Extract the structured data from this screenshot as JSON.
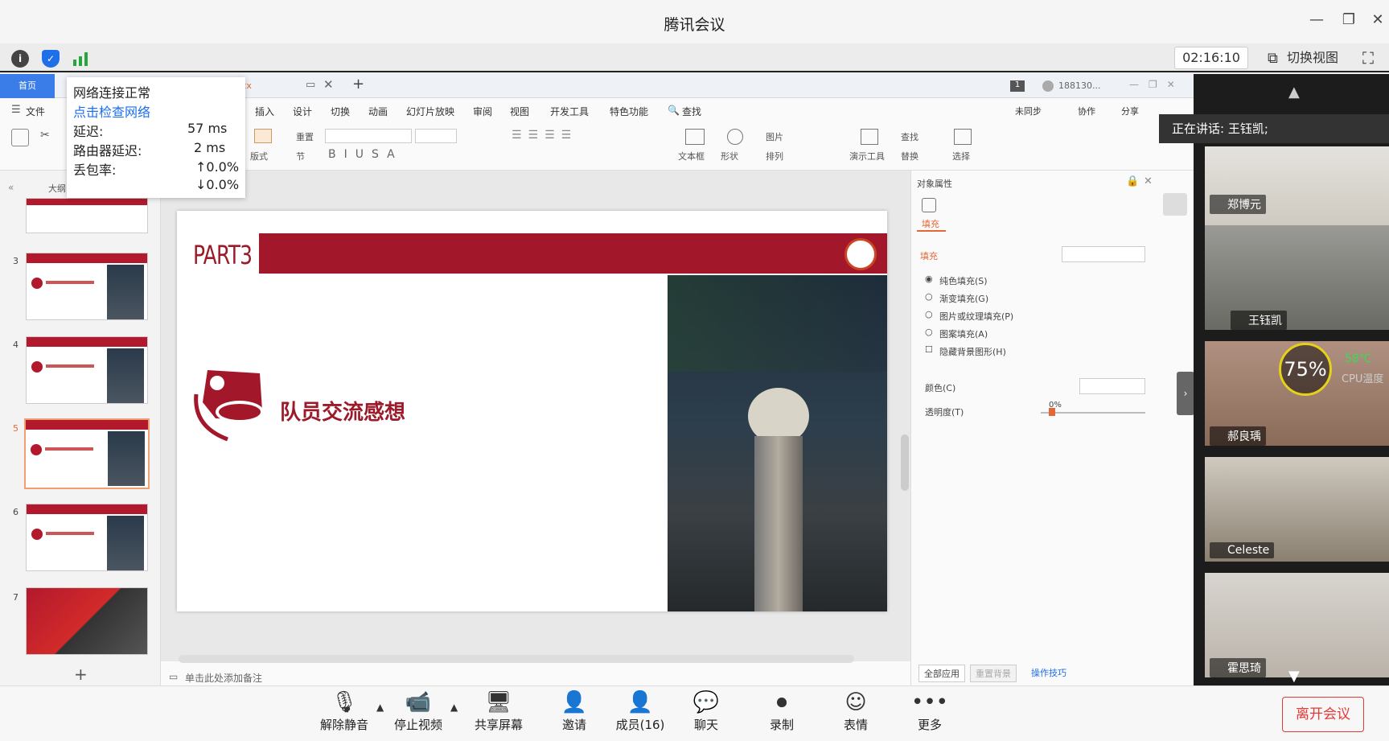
{
  "window": {
    "title": "腾讯会议",
    "timer": "02:16:10",
    "switch_view": "切换视图"
  },
  "network": {
    "status": "网络连接正常",
    "check": "点击检查网络",
    "latency_label": "延迟:",
    "latency": "57 ms",
    "router_label": "路由器延迟:",
    "router": "2 ms",
    "loss_label": "丢包率:",
    "loss_up": "↑0.0%",
    "loss_down": "↓0.0%"
  },
  "wps": {
    "home_tab": "首页",
    "tab_suffix": "tx",
    "user": "188130...",
    "menus": [
      "文件",
      "插入",
      "设计",
      "切换",
      "动画",
      "幻灯片放映",
      "审阅",
      "视图",
      "开发工具",
      "特色功能",
      "查找"
    ],
    "right_actions": [
      "未同步",
      "协作",
      "分享"
    ],
    "toolbar": {
      "reset": "重置",
      "section": "节",
      "layout": "版式",
      "textbox": "文本框",
      "shape": "形状",
      "picture": "图片",
      "arrange": "排列",
      "present": "演示工具",
      "find": "查找",
      "replace": "替换",
      "select": "选择"
    },
    "thumb_pane_label": "大纲",
    "slide_numbers": [
      "3",
      "4",
      "5",
      "6",
      "7"
    ],
    "add_slide": "+",
    "notes": "单击此处添加备注",
    "slide": {
      "part": "PART3",
      "title": "队员交流感想"
    }
  },
  "props": {
    "header": "对象属性",
    "tab": "填充",
    "section": "填充",
    "options": [
      "纯色填充(S)",
      "渐变填充(G)",
      "图片或纹理填充(P)",
      "图案填充(A)"
    ],
    "hide_bg": "隐藏背景图形(H)",
    "color_label": "颜色(C)",
    "transparency_label": "透明度(T)",
    "transparency": "0%",
    "apply_all": "全部应用",
    "reset_bg": "重置背景",
    "tips": "操作技巧"
  },
  "video": {
    "speaking": "正在讲话: 王钰凯;",
    "participants": [
      "郑博元",
      "王钰凯",
      "郝良瑀",
      "Celeste",
      "霍思琦"
    ],
    "cpu_percent": "75%",
    "cpu_temp": "58℃",
    "cpu_label": "CPU温度"
  },
  "bottom": {
    "items": [
      "解除静音",
      "停止视频",
      "共享屏幕",
      "邀请",
      "成员(16)",
      "聊天",
      "录制",
      "表情",
      "更多"
    ],
    "leave": "离开会议"
  }
}
